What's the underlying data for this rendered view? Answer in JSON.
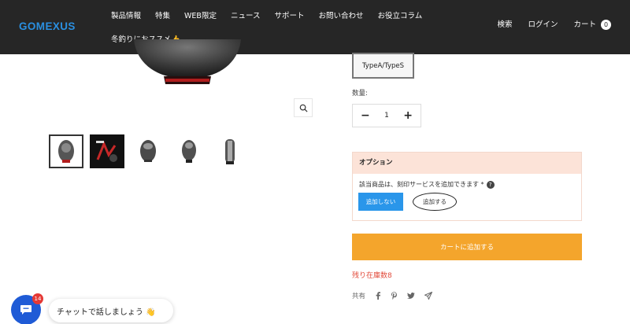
{
  "header": {
    "logo_text": "GOMEXUS",
    "nav_items": [
      "製品情報",
      "特集",
      "WEB限定",
      "ニュース",
      "サポート",
      "お問い合わせ",
      "お役立コラム"
    ],
    "nav_item_row2": "冬釣りにおススメ👍",
    "search_label": "検索",
    "login_label": "ログイン",
    "cart_label": "カート",
    "cart_count": "0"
  },
  "product": {
    "variant_label": "TypeA/TypeS",
    "quantity_label": "数量:",
    "quantity_value": "1",
    "minus_symbol": "−",
    "plus_symbol": "+"
  },
  "options": {
    "title": "オプション",
    "question": "該当商品は、刻印サービスを追加できます *",
    "question_icon": "?",
    "no_add_label": "追加しない",
    "add_label": "追加する"
  },
  "cart": {
    "add_to_cart_label": "カートに追加する",
    "stock_text": "残り在庫数8"
  },
  "share": {
    "label": "共有",
    "icons": [
      "facebook-icon",
      "pinterest-icon",
      "twitter-icon",
      "send-icon"
    ]
  },
  "chat": {
    "badge_count": "14",
    "bubble_text": "チャットで話しましょう 👋"
  },
  "colors": {
    "header_bg": "#262626",
    "logo_blue": "#2a8fe0",
    "add_to_cart": "#f4a52c",
    "option_header": "#fce3d8",
    "primary_button": "#2a96ea",
    "stock_red": "#e24a3a",
    "chat_blue": "#1f5bd6"
  }
}
